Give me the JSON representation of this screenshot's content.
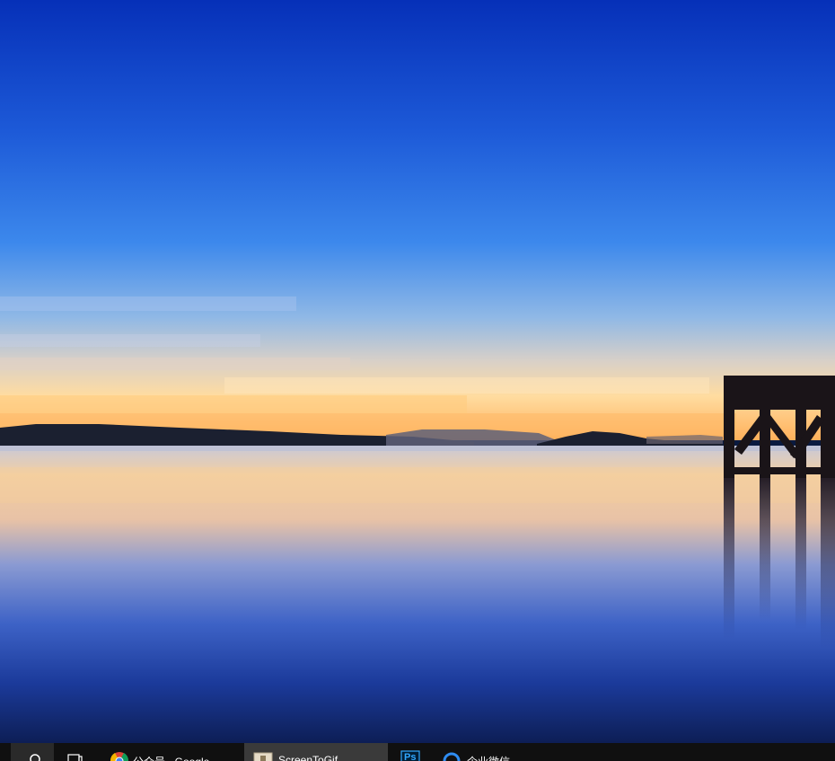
{
  "desktop": {
    "wallpaper": "sunset-lake-pier",
    "colors": {
      "sky_top": "#0a2db8",
      "sky_mid": "#2f79e8",
      "horizon_glow": "#ffc978",
      "water": "#1d3d9e"
    }
  },
  "taskbar": {
    "background": "#101010",
    "items": [
      {
        "name": "search",
        "icon": "search-icon"
      },
      {
        "name": "task-view",
        "icon": "task-view-icon"
      },
      {
        "name": "chrome",
        "icon": "chrome-icon",
        "label": "公众号 - Google"
      },
      {
        "name": "screentogif",
        "icon": "screentogif-icon",
        "label": "ScreenToGif"
      },
      {
        "name": "photoshop",
        "icon": "photoshop-icon",
        "label": "Ps"
      },
      {
        "name": "wecom",
        "icon": "wecom-icon",
        "label": "企业微信"
      }
    ]
  }
}
